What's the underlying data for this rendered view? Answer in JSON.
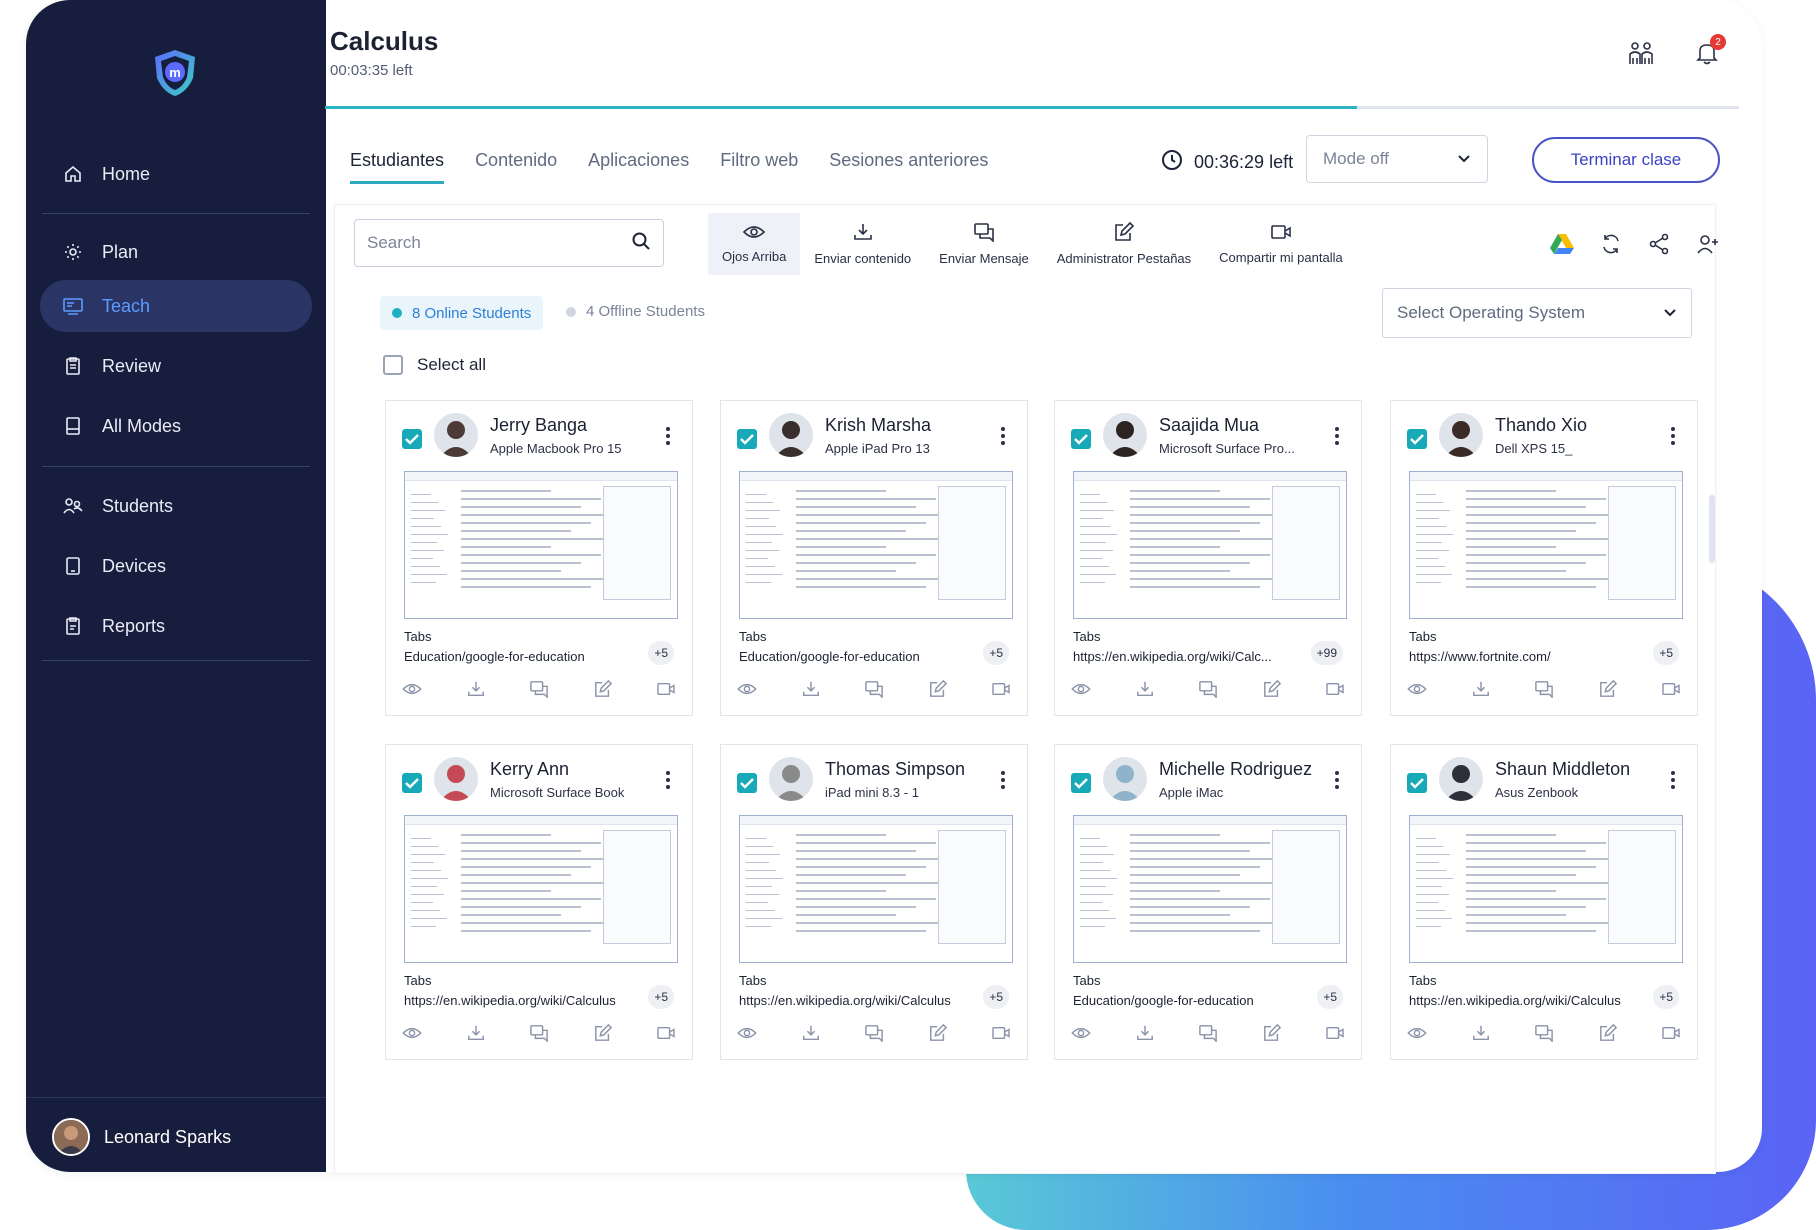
{
  "sidebar": {
    "items": [
      {
        "label": "Home",
        "icon": "home-icon"
      },
      {
        "label": "Plan",
        "icon": "gear-icon"
      },
      {
        "label": "Teach",
        "icon": "teach-board-icon"
      },
      {
        "label": "Review",
        "icon": "clipboard-icon"
      },
      {
        "label": "All Modes",
        "icon": "modes-icon"
      },
      {
        "label": "Students",
        "icon": "students-icon"
      },
      {
        "label": "Devices",
        "icon": "device-icon"
      },
      {
        "label": "Reports",
        "icon": "report-icon"
      }
    ],
    "user": "Leonard Sparks"
  },
  "header": {
    "title": "Calculus",
    "time_left": "00:03:35 left",
    "notification_count": "2",
    "progress_fraction": 0.73
  },
  "tabs": [
    "Estudiantes",
    "Contenido",
    "Aplicaciones",
    "Filtro web",
    "Sesiones anteriores"
  ],
  "session": {
    "timer": "00:36:29 left",
    "mode": "Mode off",
    "end_label": "Terminar clase"
  },
  "toolbar": {
    "search_placeholder": "Search",
    "tools": [
      "Ojos Arriba",
      "Enviar contenido",
      "Enviar Mensaje",
      "Administrator Pestañas",
      "Compartir mi pantalla"
    ]
  },
  "filters": {
    "online": "8 Online Students",
    "offline": "4 Offline Students",
    "os_select": "Select Operating System",
    "select_all": "Select all"
  },
  "students": [
    {
      "name": "Jerry Banga",
      "device": "Apple Macbook Pro 15",
      "tabs_label": "Tabs",
      "url": "Education/google-for-education",
      "count": "+5",
      "avatar": "#4b3a35"
    },
    {
      "name": "Krish Marsha",
      "device": "Apple iPad Pro 13",
      "tabs_label": "Tabs",
      "url": "Education/google-for-education",
      "count": "+5",
      "avatar": "#3a2f2c"
    },
    {
      "name": "Saajida Mua",
      "device": "Microsoft Surface Pro...",
      "tabs_label": "Tabs",
      "url": "https://en.wikipedia.org/wiki/Calc...",
      "count": "+99",
      "avatar": "#2c2422"
    },
    {
      "name": "Thando Xio",
      "device": "Dell XPS 15_",
      "tabs_label": "Tabs",
      "url": "https://www.fortnite.com/",
      "count": "+5",
      "avatar": "#3b2b28"
    },
    {
      "name": "Kerry Ann",
      "device": "Microsoft Surface Book",
      "tabs_label": "Tabs",
      "url": "https://en.wikipedia.org/wiki/Calculus",
      "count": "+5",
      "avatar": "#c44a55"
    },
    {
      "name": "Thomas Simpson",
      "device": "iPad mini 8.3 - 1",
      "tabs_label": "Tabs",
      "url": "https://en.wikipedia.org/wiki/Calculus",
      "count": "+5",
      "avatar": "#8a8a8a"
    },
    {
      "name": "Michelle Rodriguez",
      "device": "Apple iMac",
      "tabs_label": "Tabs",
      "url": "Education/google-for-education",
      "count": "+5",
      "avatar": "#8fb3c8"
    },
    {
      "name": "Shaun Middleton",
      "device": "Asus Zenbook",
      "tabs_label": "Tabs",
      "url": "https://en.wikipedia.org/wiki/Calculus",
      "count": "+5",
      "avatar": "#2d2f3a"
    }
  ],
  "colors": {
    "sidebar_bg": "#171d3c",
    "active_nav": "#2a3566",
    "accent": "#17a9b8",
    "primary_button": "#4b53c8"
  }
}
